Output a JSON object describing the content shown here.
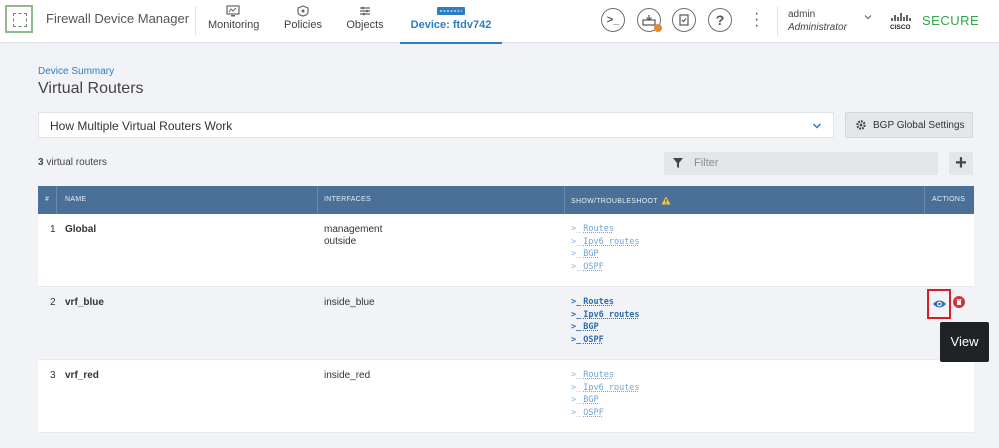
{
  "app": {
    "title": "Firewall Device Manager"
  },
  "nav": {
    "items": [
      {
        "label": "Monitoring",
        "icon": "monitoring-icon"
      },
      {
        "label": "Policies",
        "icon": "policies-icon"
      },
      {
        "label": "Objects",
        "icon": "objects-icon"
      },
      {
        "label": "Device: ftdv742",
        "icon": "device-icon"
      }
    ],
    "active": "Device: ftdv742"
  },
  "header_tools": [
    "cli-console-icon",
    "deployment-icon",
    "api-explorer-icon",
    "help-icon",
    "more-options-icon"
  ],
  "user": {
    "name": "admin",
    "role": "Administrator"
  },
  "brand": {
    "secure_label": "SECURE",
    "accent": "#2fa84a"
  },
  "page": {
    "breadcrumb": "Device Summary",
    "title": "Virtual Routers",
    "how_label": "How Multiple Virtual Routers Work",
    "bgp_button": "BGP Global Settings",
    "count_number": "3",
    "count_text": "virtual routers",
    "filter_placeholder": "Filter"
  },
  "table": {
    "headers": {
      "num": "#",
      "name": "NAME",
      "interfaces": "INTERFACES",
      "show": "SHOW/TROUBLESHOOT",
      "actions": "ACTIONS"
    },
    "rows": [
      {
        "num": "1",
        "name": "Global",
        "interfaces": [
          "management",
          "outside"
        ],
        "links": [
          "Routes",
          "Ipv6 routes",
          "BGP",
          "OSPF"
        ]
      },
      {
        "num": "2",
        "name": "vrf_blue",
        "interfaces": [
          "inside_blue"
        ],
        "links": [
          "Routes",
          "Ipv6 routes",
          "BGP",
          "OSPF"
        ]
      },
      {
        "num": "3",
        "name": "vrf_red",
        "interfaces": [
          "inside_red"
        ],
        "links": [
          "Routes",
          "Ipv6 routes",
          "BGP",
          "OSPF"
        ]
      }
    ],
    "header_color": "#4a7097",
    "link_color": "#2e6db0"
  },
  "tooltip": {
    "text": "View"
  },
  "colors": {
    "highlight": "#d81f26",
    "primary": "#2e7dc2"
  }
}
